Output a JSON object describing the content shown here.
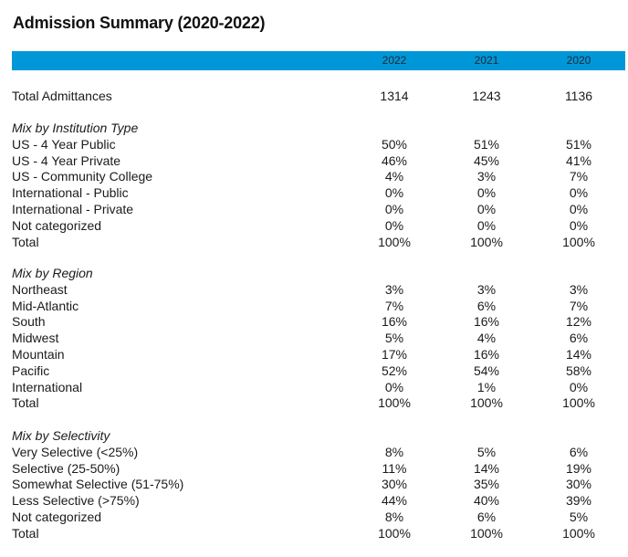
{
  "title": "Admission Summary (2020-2022)",
  "header_color": "#0097d8",
  "years": [
    "2022",
    "2021",
    "2020"
  ],
  "total_admittances": {
    "label": "Total Admittances",
    "values": [
      "1314",
      "1243",
      "1136"
    ]
  },
  "institution_type": {
    "heading": "Mix by Institution Type",
    "rows": [
      {
        "label": "US - 4 Year Public",
        "values": [
          "50%",
          "51%",
          "51%"
        ]
      },
      {
        "label": "US - 4 Year Private",
        "values": [
          "46%",
          "45%",
          "41%"
        ]
      },
      {
        "label": "US - Community College",
        "values": [
          "4%",
          "3%",
          "7%"
        ]
      },
      {
        "label": "International - Public",
        "values": [
          "0%",
          "0%",
          "0%"
        ]
      },
      {
        "label": "International - Private",
        "values": [
          "0%",
          "0%",
          "0%"
        ]
      },
      {
        "label": "Not categorized",
        "values": [
          "0%",
          "0%",
          "0%"
        ]
      },
      {
        "label": "Total",
        "values": [
          "100%",
          "100%",
          "100%"
        ]
      }
    ]
  },
  "region": {
    "heading": "Mix by Region",
    "rows": [
      {
        "label": "Northeast",
        "values": [
          "3%",
          "3%",
          "3%"
        ]
      },
      {
        "label": "Mid-Atlantic",
        "values": [
          "7%",
          "6%",
          "7%"
        ]
      },
      {
        "label": "South",
        "values": [
          "16%",
          "16%",
          "12%"
        ]
      },
      {
        "label": "Midwest",
        "values": [
          "5%",
          "4%",
          "6%"
        ]
      },
      {
        "label": "Mountain",
        "values": [
          "17%",
          "16%",
          "14%"
        ]
      },
      {
        "label": "Pacific",
        "values": [
          "52%",
          "54%",
          "58%"
        ]
      },
      {
        "label": "International",
        "values": [
          "0%",
          "1%",
          "0%"
        ]
      },
      {
        "label": "Total",
        "values": [
          "100%",
          "100%",
          "100%"
        ]
      }
    ]
  },
  "selectivity": {
    "heading": "Mix by Selectivity",
    "rows": [
      {
        "label": "Very Selective (<25%)",
        "values": [
          "8%",
          "5%",
          "6%"
        ]
      },
      {
        "label": "Selective (25-50%)",
        "values": [
          "11%",
          "14%",
          "19%"
        ]
      },
      {
        "label": "Somewhat Selective (51-75%)",
        "values": [
          "30%",
          "35%",
          "30%"
        ]
      },
      {
        "label": "Less Selective (>75%)",
        "values": [
          "44%",
          "40%",
          "39%"
        ]
      },
      {
        "label": "Not categorized",
        "values": [
          "8%",
          "6%",
          "5%"
        ]
      },
      {
        "label": "Total",
        "values": [
          "100%",
          "100%",
          "100%"
        ]
      }
    ]
  }
}
